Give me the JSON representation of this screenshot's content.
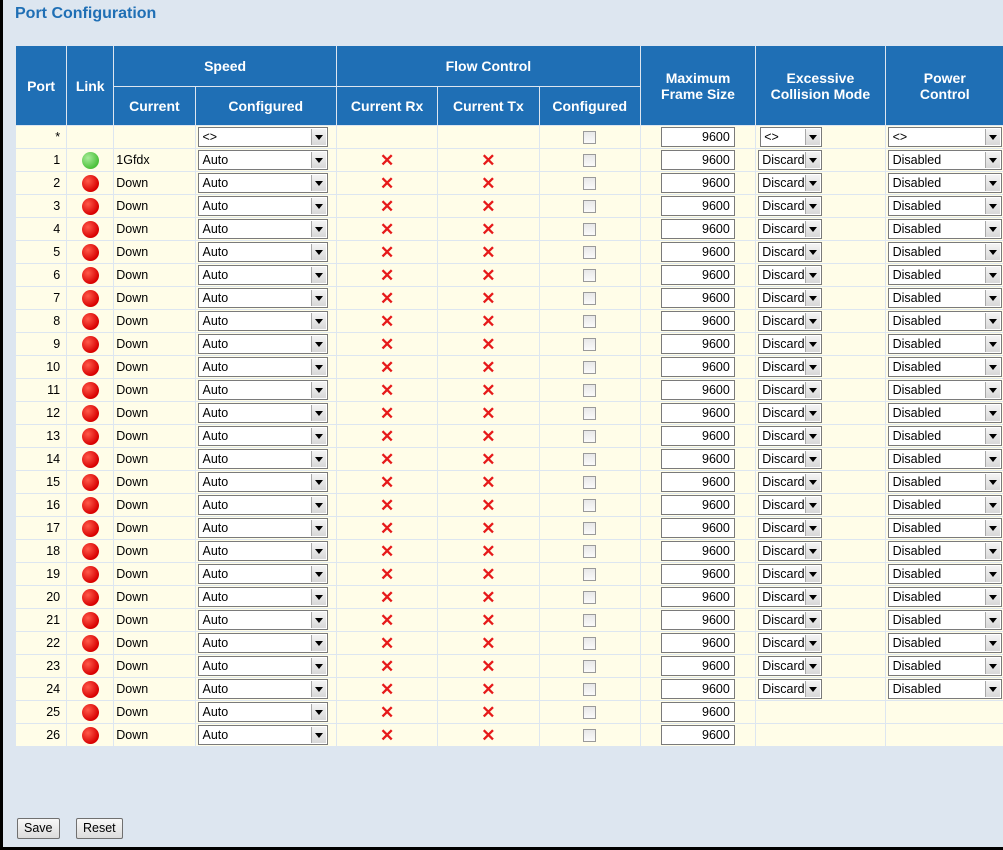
{
  "page": {
    "title": "Port Configuration"
  },
  "headers": {
    "port": "Port",
    "link": "Link",
    "speed": "Speed",
    "speed_current": "Current",
    "speed_configured": "Configured",
    "flow_control": "Flow Control",
    "fc_current_rx": "Current Rx",
    "fc_current_tx": "Current Tx",
    "fc_configured": "Configured",
    "max_frame_1": "Maximum",
    "max_frame_2": "Frame Size",
    "excessive_1": "Excessive",
    "excessive_2": "Collision Mode",
    "power_1": "Power",
    "power_2": "Control"
  },
  "wildcard_row": {
    "port": "*",
    "speed_configured": "<>",
    "max_frame": "9600",
    "excessive": "<>",
    "power": "<>"
  },
  "rows": [
    {
      "port": "1",
      "link": "up",
      "current": "1Gfdx",
      "configured": "Auto",
      "rx": "x",
      "tx": "x",
      "max_frame": "9600",
      "excessive": "Discard",
      "power": "Disabled"
    },
    {
      "port": "2",
      "link": "down",
      "current": "Down",
      "configured": "Auto",
      "rx": "x",
      "tx": "x",
      "max_frame": "9600",
      "excessive": "Discard",
      "power": "Disabled"
    },
    {
      "port": "3",
      "link": "down",
      "current": "Down",
      "configured": "Auto",
      "rx": "x",
      "tx": "x",
      "max_frame": "9600",
      "excessive": "Discard",
      "power": "Disabled"
    },
    {
      "port": "4",
      "link": "down",
      "current": "Down",
      "configured": "Auto",
      "rx": "x",
      "tx": "x",
      "max_frame": "9600",
      "excessive": "Discard",
      "power": "Disabled"
    },
    {
      "port": "5",
      "link": "down",
      "current": "Down",
      "configured": "Auto",
      "rx": "x",
      "tx": "x",
      "max_frame": "9600",
      "excessive": "Discard",
      "power": "Disabled"
    },
    {
      "port": "6",
      "link": "down",
      "current": "Down",
      "configured": "Auto",
      "rx": "x",
      "tx": "x",
      "max_frame": "9600",
      "excessive": "Discard",
      "power": "Disabled"
    },
    {
      "port": "7",
      "link": "down",
      "current": "Down",
      "configured": "Auto",
      "rx": "x",
      "tx": "x",
      "max_frame": "9600",
      "excessive": "Discard",
      "power": "Disabled"
    },
    {
      "port": "8",
      "link": "down",
      "current": "Down",
      "configured": "Auto",
      "rx": "x",
      "tx": "x",
      "max_frame": "9600",
      "excessive": "Discard",
      "power": "Disabled"
    },
    {
      "port": "9",
      "link": "down",
      "current": "Down",
      "configured": "Auto",
      "rx": "x",
      "tx": "x",
      "max_frame": "9600",
      "excessive": "Discard",
      "power": "Disabled"
    },
    {
      "port": "10",
      "link": "down",
      "current": "Down",
      "configured": "Auto",
      "rx": "x",
      "tx": "x",
      "max_frame": "9600",
      "excessive": "Discard",
      "power": "Disabled"
    },
    {
      "port": "11",
      "link": "down",
      "current": "Down",
      "configured": "Auto",
      "rx": "x",
      "tx": "x",
      "max_frame": "9600",
      "excessive": "Discard",
      "power": "Disabled"
    },
    {
      "port": "12",
      "link": "down",
      "current": "Down",
      "configured": "Auto",
      "rx": "x",
      "tx": "x",
      "max_frame": "9600",
      "excessive": "Discard",
      "power": "Disabled"
    },
    {
      "port": "13",
      "link": "down",
      "current": "Down",
      "configured": "Auto",
      "rx": "x",
      "tx": "x",
      "max_frame": "9600",
      "excessive": "Discard",
      "power": "Disabled"
    },
    {
      "port": "14",
      "link": "down",
      "current": "Down",
      "configured": "Auto",
      "rx": "x",
      "tx": "x",
      "max_frame": "9600",
      "excessive": "Discard",
      "power": "Disabled"
    },
    {
      "port": "15",
      "link": "down",
      "current": "Down",
      "configured": "Auto",
      "rx": "x",
      "tx": "x",
      "max_frame": "9600",
      "excessive": "Discard",
      "power": "Disabled"
    },
    {
      "port": "16",
      "link": "down",
      "current": "Down",
      "configured": "Auto",
      "rx": "x",
      "tx": "x",
      "max_frame": "9600",
      "excessive": "Discard",
      "power": "Disabled"
    },
    {
      "port": "17",
      "link": "down",
      "current": "Down",
      "configured": "Auto",
      "rx": "x",
      "tx": "x",
      "max_frame": "9600",
      "excessive": "Discard",
      "power": "Disabled"
    },
    {
      "port": "18",
      "link": "down",
      "current": "Down",
      "configured": "Auto",
      "rx": "x",
      "tx": "x",
      "max_frame": "9600",
      "excessive": "Discard",
      "power": "Disabled"
    },
    {
      "port": "19",
      "link": "down",
      "current": "Down",
      "configured": "Auto",
      "rx": "x",
      "tx": "x",
      "max_frame": "9600",
      "excessive": "Discard",
      "power": "Disabled"
    },
    {
      "port": "20",
      "link": "down",
      "current": "Down",
      "configured": "Auto",
      "rx": "x",
      "tx": "x",
      "max_frame": "9600",
      "excessive": "Discard",
      "power": "Disabled"
    },
    {
      "port": "21",
      "link": "down",
      "current": "Down",
      "configured": "Auto",
      "rx": "x",
      "tx": "x",
      "max_frame": "9600",
      "excessive": "Discard",
      "power": "Disabled"
    },
    {
      "port": "22",
      "link": "down",
      "current": "Down",
      "configured": "Auto",
      "rx": "x",
      "tx": "x",
      "max_frame": "9600",
      "excessive": "Discard",
      "power": "Disabled"
    },
    {
      "port": "23",
      "link": "down",
      "current": "Down",
      "configured": "Auto",
      "rx": "x",
      "tx": "x",
      "max_frame": "9600",
      "excessive": "Discard",
      "power": "Disabled"
    },
    {
      "port": "24",
      "link": "down",
      "current": "Down",
      "configured": "Auto",
      "rx": "x",
      "tx": "x",
      "max_frame": "9600",
      "excessive": "Discard",
      "power": "Disabled"
    },
    {
      "port": "25",
      "link": "down",
      "current": "Down",
      "configured": "Auto",
      "rx": "x",
      "tx": "x",
      "max_frame": "9600",
      "excessive": null,
      "power": null
    },
    {
      "port": "26",
      "link": "down",
      "current": "Down",
      "configured": "Auto",
      "rx": "x",
      "tx": "x",
      "max_frame": "9600",
      "excessive": null,
      "power": null
    }
  ],
  "buttons": {
    "save": "Save",
    "reset": "Reset"
  },
  "icons": {
    "link_up": "green-dot-icon",
    "link_down": "red-dot-icon",
    "not_enabled": "red-x-icon"
  },
  "colors": {
    "header_bg": "#1f6fb5",
    "title": "#1f6fb5",
    "row_bg": "#fffde8",
    "link_up": "#4cc13a",
    "link_down": "#d80000",
    "x_mark": "#e61a1a"
  }
}
